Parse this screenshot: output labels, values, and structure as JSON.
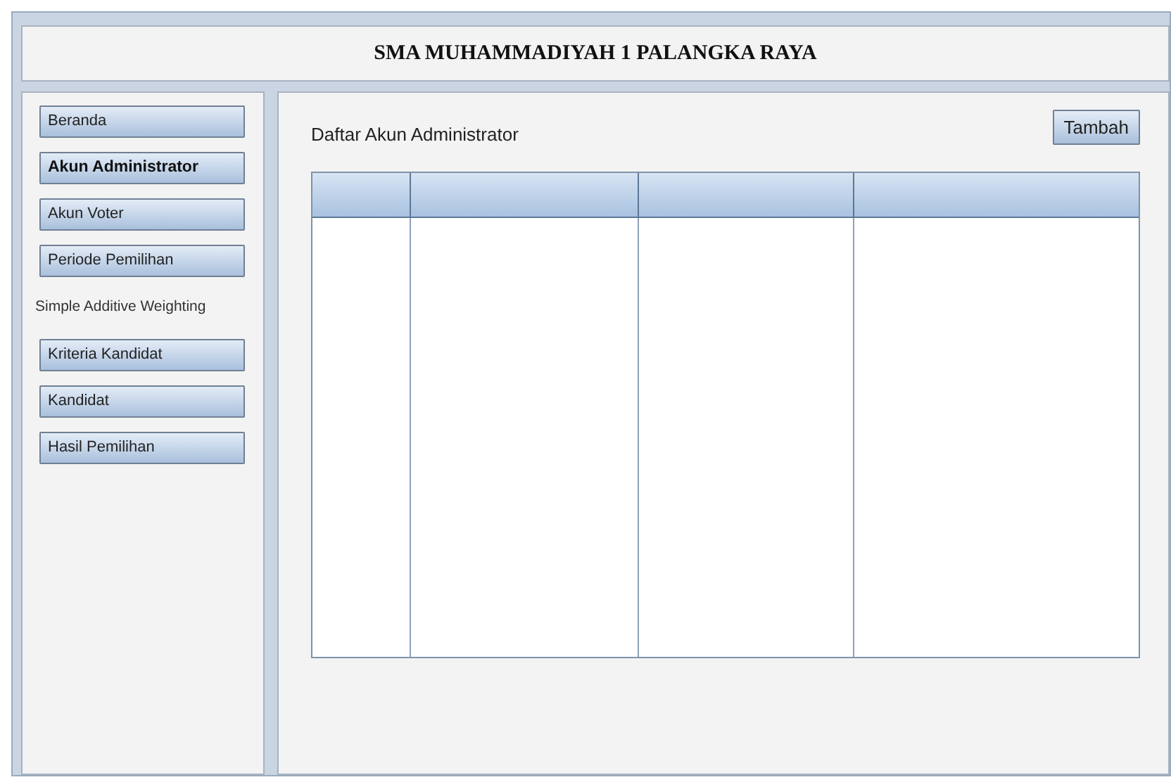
{
  "header": {
    "title": "SMA MUHAMMADIYAH 1 PALANGKA RAYA"
  },
  "sidebar": {
    "items": [
      {
        "label": "Beranda",
        "kind": "button",
        "selected": false
      },
      {
        "label": "Akun Administrator",
        "kind": "button",
        "selected": true
      },
      {
        "label": "Akun Voter",
        "kind": "button",
        "selected": false
      },
      {
        "label": "Periode Pemilihan",
        "kind": "button",
        "selected": false
      },
      {
        "label": "Simple Additive Weighting",
        "kind": "label",
        "selected": false
      },
      {
        "label": "Kriteria Kandidat",
        "kind": "button",
        "selected": false
      },
      {
        "label": "Kandidat",
        "kind": "button",
        "selected": false
      },
      {
        "label": "Hasil Pemilihan",
        "kind": "button",
        "selected": false
      }
    ]
  },
  "content": {
    "title": "Daftar Akun Administrator",
    "add_button": "Tambah"
  }
}
